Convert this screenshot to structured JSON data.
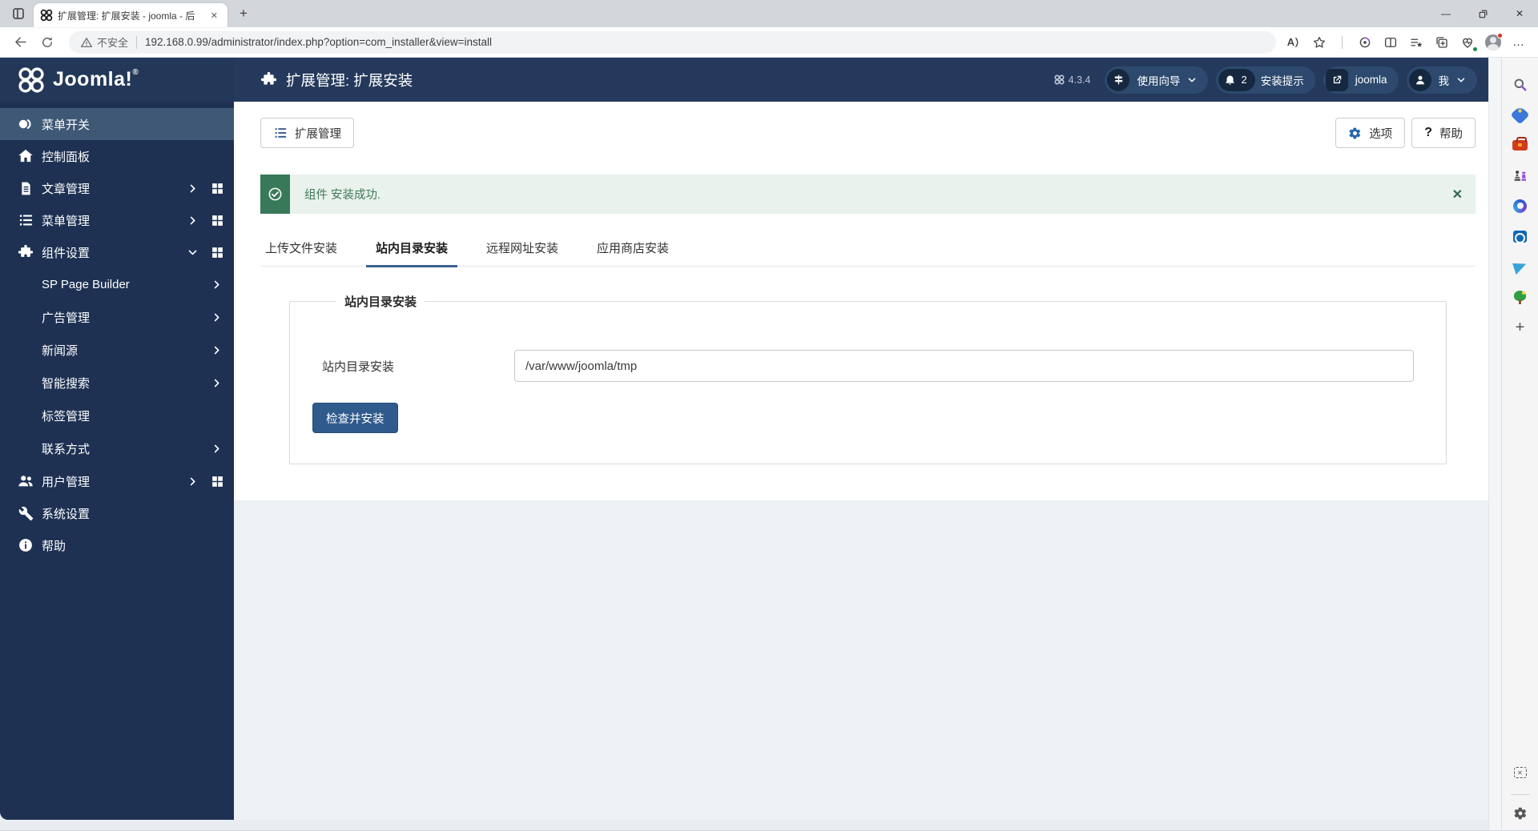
{
  "browser": {
    "tab_title": "扩展管理: 扩展安装 - joomla - 后",
    "security_label": "不安全",
    "url": "192.168.0.99/administrator/index.php?option=com_installer&view=install",
    "icons": {
      "read_aloud": "A"
    }
  },
  "glyphs": {
    "close": "✕",
    "plus": "+",
    "more": "…",
    "minimize": "—",
    "question": "?"
  },
  "admin_header": {
    "page_title": "扩展管理: 扩展安装",
    "version": "4.3.4",
    "guide_button": "使用向导",
    "notifications_count": "2",
    "notifications_label": "安装提示",
    "site_link": "joomla",
    "user_menu": "我"
  },
  "sidebar": {
    "logo": "Joomla!",
    "logo_mark": "®",
    "items": [
      {
        "label": "菜单开关"
      },
      {
        "label": "控制面板"
      },
      {
        "label": "文章管理"
      },
      {
        "label": "菜单管理"
      },
      {
        "label": "组件设置"
      },
      {
        "label": "用户管理"
      },
      {
        "label": "系统设置"
      },
      {
        "label": "帮助"
      }
    ],
    "submenu": [
      {
        "label": "SP Page Builder"
      },
      {
        "label": "广告管理"
      },
      {
        "label": "新闻源"
      },
      {
        "label": "智能搜索"
      },
      {
        "label": "标签管理"
      },
      {
        "label": "联系方式"
      }
    ]
  },
  "toolbar": {
    "manager_button": "扩展管理",
    "options_button": "选项",
    "help_button": "帮助"
  },
  "alert": {
    "message": "组件 安装成功."
  },
  "tabs": {
    "items": [
      {
        "label": "上传文件安装"
      },
      {
        "label": "站内目录安装"
      },
      {
        "label": "远程网址安装"
      },
      {
        "label": "应用商店安装"
      }
    ]
  },
  "install_form": {
    "legend": "站内目录安装",
    "field_label": "站内目录安装",
    "field_value": "/var/www/joomla/tmp",
    "submit_label": "检查并安装"
  }
}
